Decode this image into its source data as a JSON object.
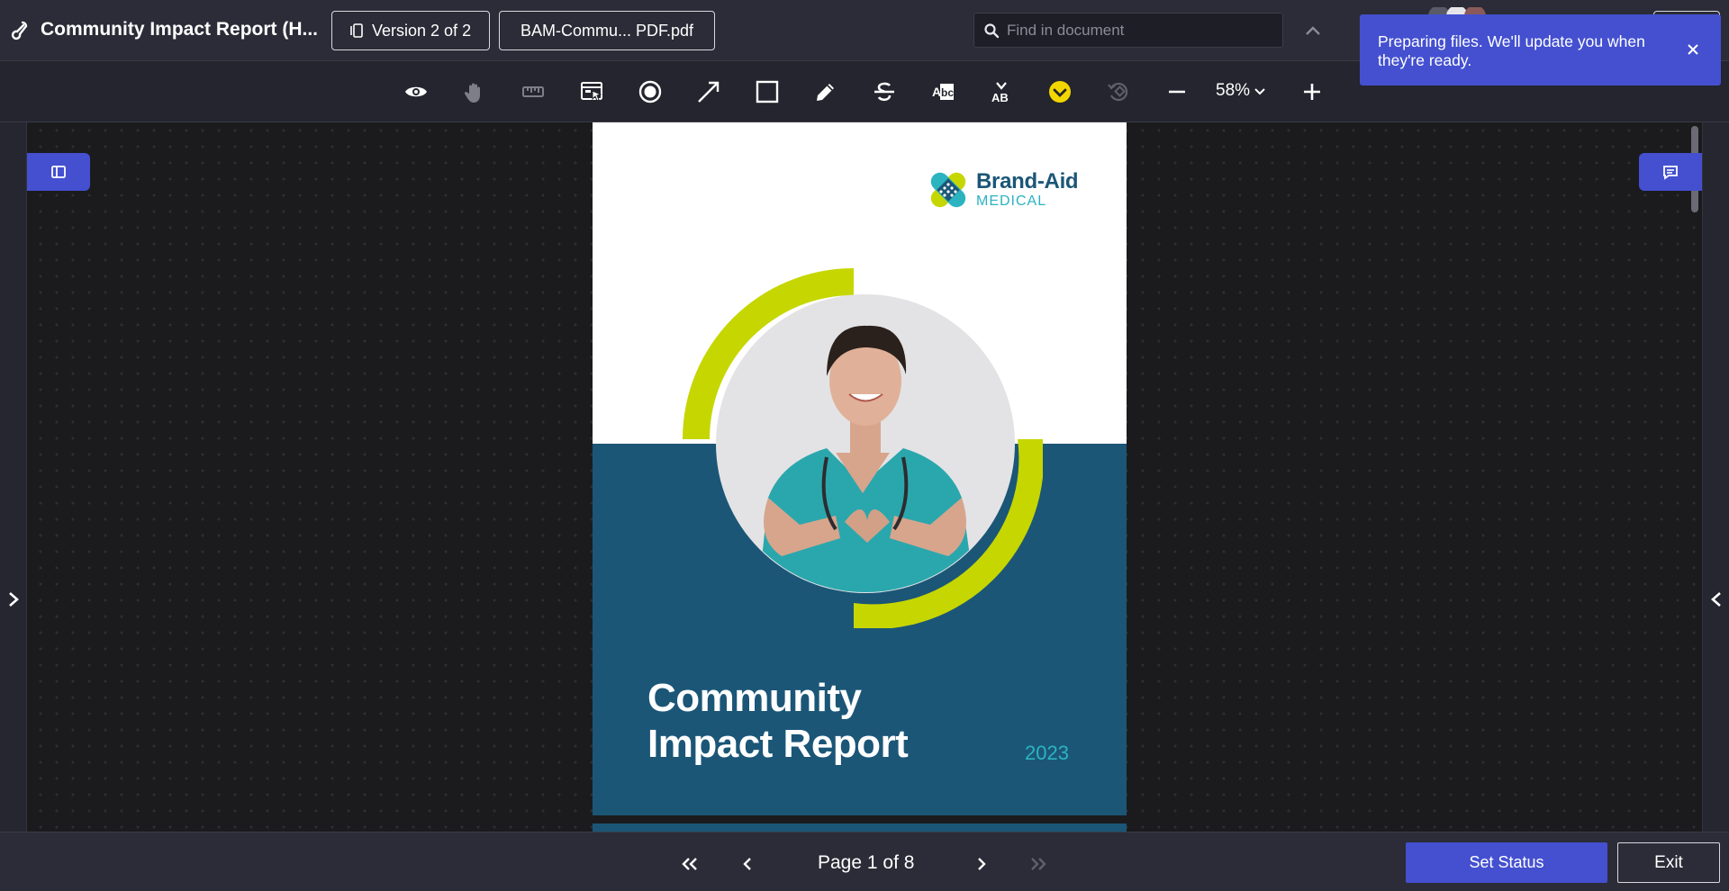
{
  "header": {
    "title": "Community Impact Report (H...",
    "version_label": "Version 2 of 2",
    "file_label": "BAM-Commu... PDF.pdf",
    "search_placeholder": "Find in document"
  },
  "toast": {
    "message": "Preparing files. We'll update you when they're ready."
  },
  "toolbar": {
    "tools": [
      "eye-icon",
      "hand-icon",
      "ruler-icon",
      "select-area-icon",
      "record-icon",
      "arrow-icon",
      "rectangle-icon",
      "pencil-icon",
      "strikethrough-icon",
      "text-replace-icon",
      "text-insert-icon",
      "checkmark-stamp-icon",
      "rotate-icon"
    ],
    "zoom_level": "58%"
  },
  "document": {
    "brand_name": "Brand-Aid",
    "brand_sub": "MEDICAL",
    "title_line1": "Community",
    "title_line2": "Impact Report",
    "year": "2023"
  },
  "footer": {
    "page_indicator": "Page 1 of 8",
    "set_status_label": "Set Status",
    "exit_label": "Exit"
  },
  "colors": {
    "accent": "#4450d0",
    "doc_blue": "#1b5677",
    "doc_lime": "#c6d600",
    "doc_teal": "#2bb3c0"
  }
}
